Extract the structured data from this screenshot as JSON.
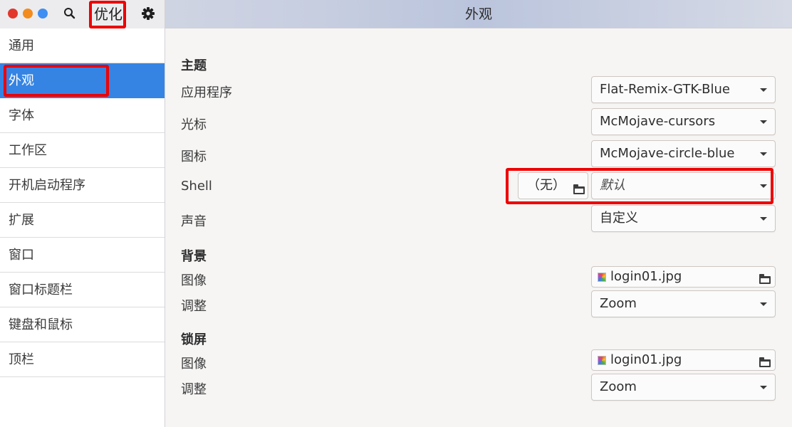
{
  "app": {
    "title": "优化",
    "page_title": "外观"
  },
  "window_controls": [
    "close",
    "minimize",
    "maximize"
  ],
  "icons": {
    "search": "search-icon",
    "settings": "gear-icon",
    "folder": "folder-icon"
  },
  "colors": {
    "accent": "#3584e4",
    "highlight": "#ee0000"
  },
  "sidebar": {
    "items": [
      {
        "label": "通用",
        "selected": false
      },
      {
        "label": "外观",
        "selected": true
      },
      {
        "label": "字体",
        "selected": false
      },
      {
        "label": "工作区",
        "selected": false
      },
      {
        "label": "开机启动程序",
        "selected": false
      },
      {
        "label": "扩展",
        "selected": false
      },
      {
        "label": "窗口",
        "selected": false
      },
      {
        "label": "窗口标题栏",
        "selected": false
      },
      {
        "label": "键盘和鼠标",
        "selected": false
      },
      {
        "label": "顶栏",
        "selected": false
      }
    ]
  },
  "main": {
    "themes": {
      "title": "主题",
      "applications_label": "应用程序",
      "applications_value": "Flat-Remix-GTK-Blue",
      "cursor_label": "光标",
      "cursor_value": "McMojave-cursors",
      "icons_label": "图标",
      "icons_value": "McMojave-circle-blue",
      "shell_label": "Shell",
      "shell_file_value": "（无）",
      "shell_value": "默认",
      "sound_label": "声音",
      "sound_value": "自定义"
    },
    "background": {
      "title": "背景",
      "image_label": "图像",
      "image_value": "login01.jpg",
      "adjust_label": "调整",
      "adjust_value": "Zoom"
    },
    "lock_screen": {
      "title": "锁屏",
      "image_label": "图像",
      "image_value": "login01.jpg",
      "adjust_label": "调整",
      "adjust_value": "Zoom"
    }
  }
}
